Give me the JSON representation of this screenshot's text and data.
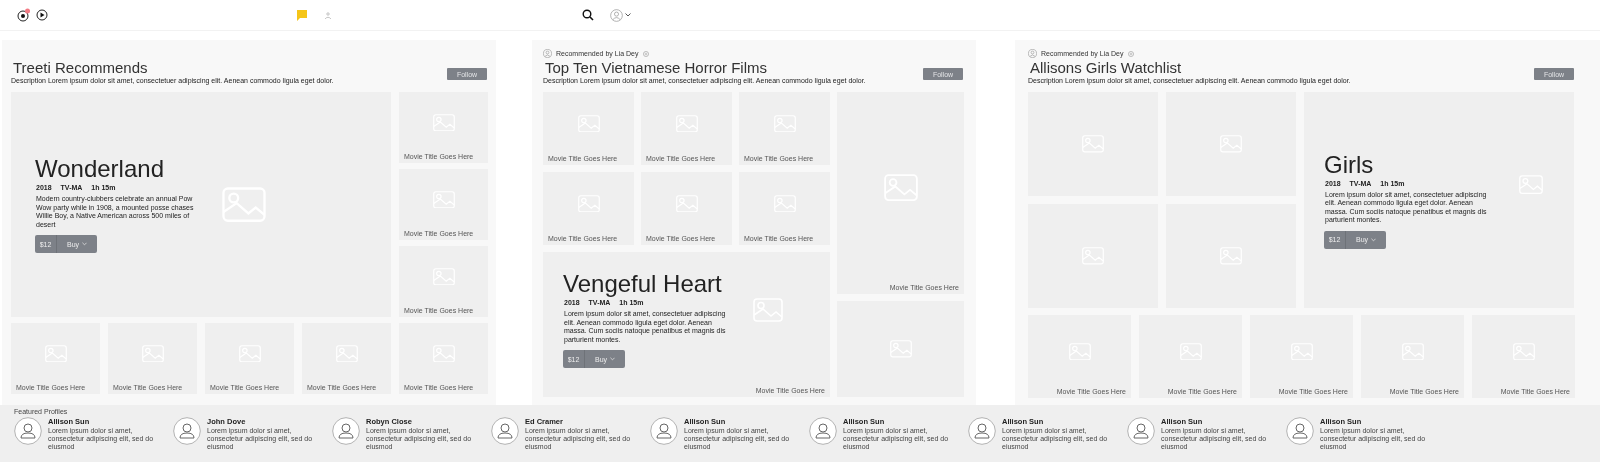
{
  "panels": [
    {
      "kind": "hero-left",
      "title": "Treeti Recommends",
      "description": "Description Lorem ipsum dolor sit amet, consectetuer adipiscing elit. Aenean commodo ligula eget dolor.",
      "follow_label": "Follow",
      "items": [
        {
          "kind": "hero",
          "title": "Wonderland",
          "year": "2018",
          "rating": "TV-MA",
          "duration": "1h 15m",
          "synopsis": "Modern country-clubbers celebrate an annual Pow Wow party while in 1908, a mounted posse chases Willie Boy, a Native American across 500 miles of desert",
          "price": "$12",
          "buy_label": "Buy"
        },
        {
          "kind": "tile",
          "caption": "Movie Title Goes Here"
        },
        {
          "kind": "tile",
          "caption": "Movie Title Goes Here"
        },
        {
          "kind": "tile",
          "caption": "Movie Title Goes Here"
        },
        {
          "kind": "tile",
          "caption": "Movie Title Goes Here"
        },
        {
          "kind": "tile",
          "caption": "Movie Title Goes Here"
        },
        {
          "kind": "tile",
          "caption": "Movie Title Goes Here"
        },
        {
          "kind": "tile",
          "caption": "Movie Title Goes Here"
        },
        {
          "kind": "tile",
          "caption": "Movie Title Goes Here"
        }
      ]
    },
    {
      "kind": "hero-bottom",
      "recommended_by": "Recommended by Lia Dey",
      "title": "Top Ten Vietnamese Horror Films",
      "description": "Description Lorem ipsum dolor sit amet, consectetuer adipiscing elit. Aenean commodo ligula eget dolor.",
      "follow_label": "Follow",
      "items": [
        {
          "kind": "tile",
          "caption": "Movie Title Goes Here"
        },
        {
          "kind": "tile",
          "caption": "Movie Title Goes Here"
        },
        {
          "kind": "tile",
          "caption": "Movie Title Goes Here"
        },
        {
          "kind": "tile",
          "caption": "Movie Title Goes Here"
        },
        {
          "kind": "tile",
          "caption": "Movie Title Goes Here"
        },
        {
          "kind": "tile",
          "caption": "Movie Title Goes Here"
        },
        {
          "kind": "tile",
          "caption": "Movie Title Goes Here"
        },
        {
          "kind": "hero",
          "title": "Vengeful Heart",
          "year": "2018",
          "rating": "TV-MA",
          "duration": "1h 15m",
          "synopsis": "Lorem ipsum dolor sit amet, consectetuer adipiscing elit. Aenean commodo ligula eget dolor. Aenean massa. Cum sociis natoque penatibus et magnis dis parturient montes.",
          "price": "$12",
          "buy_label": "Buy",
          "caption": "Movie Title Goes Here"
        },
        {
          "kind": "tile"
        }
      ]
    },
    {
      "kind": "hero-right",
      "recommended_by": "Recommended by Lia Dey",
      "title": "Allisons Girls Watchlist",
      "description": "Description Lorem ipsum dolor sit amet, consectetuer adipiscing elit. Aenean commodo ligula eget dolor.",
      "follow_label": "Follow",
      "items": [
        {
          "kind": "tile"
        },
        {
          "kind": "tile"
        },
        {
          "kind": "hero",
          "title": "Girls",
          "year": "2018",
          "rating": "TV-MA",
          "duration": "1h 15m",
          "synopsis": "Lorem ipsum dolor sit amet, consectetuer adipiscing elit. Aenean commodo ligula eget dolor. Aenean massa. Cum sociis natoque penatibus et magnis dis parturient montes.",
          "price": "$12",
          "buy_label": "Buy"
        },
        {
          "kind": "tile"
        },
        {
          "kind": "tile"
        },
        {
          "kind": "tile",
          "caption": "Movie Title Goes Here"
        },
        {
          "kind": "tile",
          "caption": "Movie Title Goes Here"
        },
        {
          "kind": "tile",
          "caption": "Movie Title Goes Here"
        },
        {
          "kind": "tile",
          "caption": "Movie Title Goes Here"
        },
        {
          "kind": "tile",
          "caption": "Movie Title Goes Here"
        }
      ]
    }
  ],
  "featured_profiles": {
    "label": "Featured Profiles",
    "profiles": [
      {
        "name": "Allison Sun",
        "bio": "Lorem ipsum dolor si amet, consectetur adipiscing elit, sed do eiusmod"
      },
      {
        "name": "John Dove",
        "bio": "Lorem ipsum dolor si amet, consectetur adipiscing elit, sed do eiusmod"
      },
      {
        "name": "Robyn Close",
        "bio": "Lorem ipsum dolor si amet, consectetur adipiscing elit, sed do eiusmod"
      },
      {
        "name": "Ed Cramer",
        "bio": "Lorem ipsum dolor si amet, consectetur adipiscing elit, sed do eiusmod"
      },
      {
        "name": "Allison Sun",
        "bio": "Lorem ipsum dolor si amet, consectetur adipiscing elit, sed do eiusmod"
      },
      {
        "name": "Allison Sun",
        "bio": "Lorem ipsum dolor si amet, consectetur adipiscing elit, sed do eiusmod"
      },
      {
        "name": "Allison Sun",
        "bio": "Lorem ipsum dolor si amet, consectetur adipiscing elit, sed do eiusmod"
      },
      {
        "name": "Allison Sun",
        "bio": "Lorem ipsum dolor si amet, consectetur adipiscing elit, sed do eiusmod"
      },
      {
        "name": "Allison Sun",
        "bio": "Lorem ipsum dolor si amet, consectetur adipiscing elit, sed do eiusmod"
      }
    ]
  }
}
